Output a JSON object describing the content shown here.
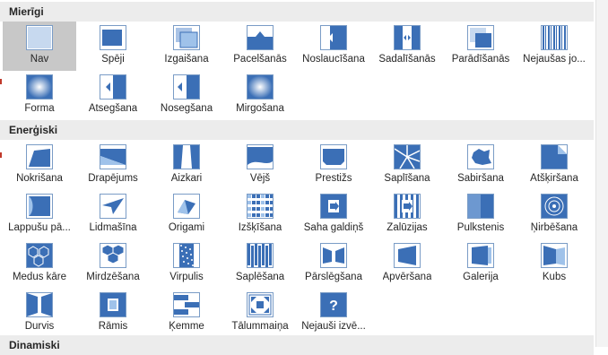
{
  "sections": [
    {
      "title": "Mierīgi"
    },
    {
      "title": "Enerģiski"
    },
    {
      "title": "Dinamiski"
    }
  ],
  "calm": [
    [
      {
        "label": "Nav",
        "icon": "none-icon"
      },
      {
        "label": "Spēji",
        "icon": "cut-icon"
      },
      {
        "label": "Izgaišana",
        "icon": "fade-icon"
      },
      {
        "label": "Pacelšanās",
        "icon": "push-up-icon"
      },
      {
        "label": "Noslaucīšana",
        "icon": "wipe-icon"
      },
      {
        "label": "Sadalīšanās",
        "icon": "split-icon"
      },
      {
        "label": "Parādīšanās",
        "icon": "reveal-icon"
      },
      {
        "label": "Nejaušas jo...",
        "icon": "random-bars-icon"
      }
    ],
    [
      {
        "label": "Forma",
        "icon": "shape-icon"
      },
      {
        "label": "Atsegšana",
        "icon": "uncover-icon"
      },
      {
        "label": "Nosegšana",
        "icon": "cover-icon"
      },
      {
        "label": "Mirgošana",
        "icon": "flash-icon"
      }
    ]
  ],
  "exciting": [
    [
      {
        "label": "Nokrišana",
        "icon": "fall-over-icon"
      },
      {
        "label": "Drapējums",
        "icon": "drape-icon"
      },
      {
        "label": "Aizkari",
        "icon": "curtains-icon"
      },
      {
        "label": "Vējš",
        "icon": "wind-icon"
      },
      {
        "label": "Prestižs",
        "icon": "prestige-icon"
      },
      {
        "label": "Saplīšana",
        "icon": "fracture-icon"
      },
      {
        "label": "Sabiršana",
        "icon": "crush-icon"
      },
      {
        "label": "Atšķiršana",
        "icon": "peel-off-icon"
      }
    ],
    [
      {
        "label": "Lappušu pā...",
        "icon": "page-curl-icon"
      },
      {
        "label": "Lidmašīna",
        "icon": "airplane-icon"
      },
      {
        "label": "Origami",
        "icon": "origami-icon"
      },
      {
        "label": "Izšķīšana",
        "icon": "dissolve-icon"
      },
      {
        "label": "Šaha galdiņš",
        "icon": "checkerboard-icon"
      },
      {
        "label": "Žalūzijas",
        "icon": "blinds-icon"
      },
      {
        "label": "Pulkstenis",
        "icon": "clock-icon"
      },
      {
        "label": "Ņirbēšana",
        "icon": "ripple-icon"
      }
    ],
    [
      {
        "label": "Medus kāre",
        "icon": "honeycomb-icon"
      },
      {
        "label": "Mirdzēšana",
        "icon": "glitter-icon"
      },
      {
        "label": "Virpulis",
        "icon": "vortex-icon"
      },
      {
        "label": "Saplēšana",
        "icon": "shred-icon"
      },
      {
        "label": "Pārslēgšana",
        "icon": "switch-icon"
      },
      {
        "label": "Apvēršana",
        "icon": "flip-icon"
      },
      {
        "label": "Galerija",
        "icon": "gallery-icon"
      },
      {
        "label": "Kubs",
        "icon": "cube-icon"
      }
    ],
    [
      {
        "label": "Durvis",
        "icon": "doors-icon"
      },
      {
        "label": "Rāmis",
        "icon": "box-icon"
      },
      {
        "label": "Ķemme",
        "icon": "comb-icon"
      },
      {
        "label": "Tālummaiņa",
        "icon": "zoom-icon"
      },
      {
        "label": "Nejauši izvē...",
        "icon": "random-icon"
      }
    ]
  ],
  "colors": {
    "accent": "#3b6fb6",
    "light": "#9fc2ea",
    "header_bg": "#ececec",
    "selected_bg": "#c8c8c8"
  }
}
